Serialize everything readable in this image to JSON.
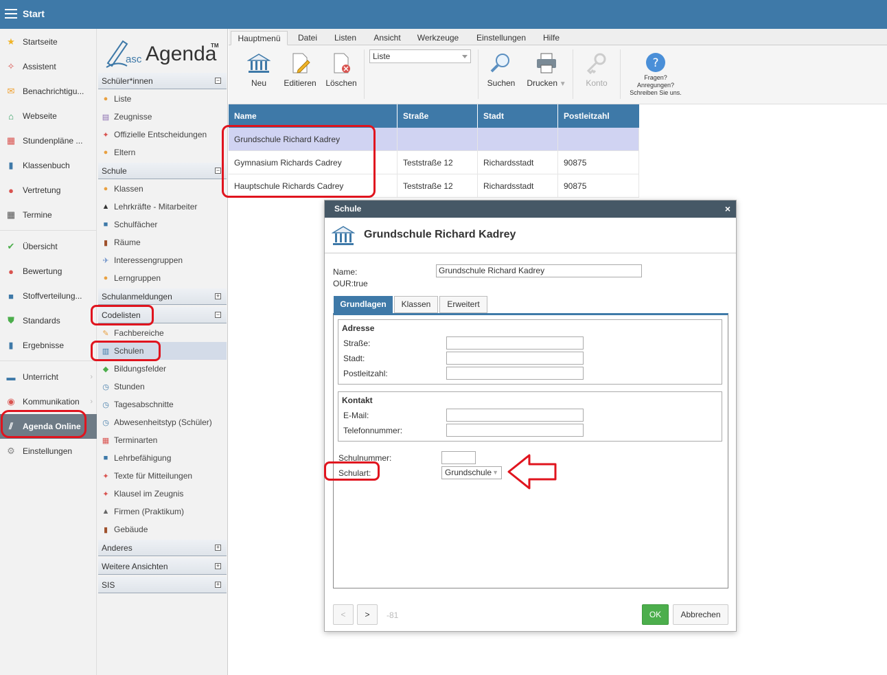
{
  "topbar": {
    "title": "Start"
  },
  "leftnav": {
    "items": [
      {
        "label": "Startseite",
        "icon": "star-icon",
        "color": "#f0b428"
      },
      {
        "label": "Assistent",
        "icon": "magic-wand-icon",
        "color": "#d9534f"
      },
      {
        "label": "Benachrichtigu...",
        "icon": "envelope-icon",
        "color": "#f0a030"
      },
      {
        "label": "Webseite",
        "icon": "house-icon",
        "color": "#2e9e5e"
      },
      {
        "label": "Stundenpläne ...",
        "icon": "timetable-icon",
        "color": "#d9534f"
      },
      {
        "label": "Klassenbuch",
        "icon": "book-icon",
        "color": "#3e79a8"
      },
      {
        "label": "Vertretung",
        "icon": "person-icon",
        "color": "#d9534f"
      },
      {
        "label": "Termine",
        "icon": "calendar-icon",
        "color": "#555"
      },
      {
        "label": "Übersicht",
        "icon": "check-circle-icon",
        "color": "#4cae4c"
      },
      {
        "label": "Bewertung",
        "icon": "grade-icon",
        "color": "#d9534f"
      },
      {
        "label": "Stoffverteilung...",
        "icon": "briefcase-icon",
        "color": "#3e79a8"
      },
      {
        "label": "Standards",
        "icon": "shield-check-icon",
        "color": "#4cae4c"
      },
      {
        "label": "Ergebnisse",
        "icon": "bar-chart-icon",
        "color": "#3e79a8"
      },
      {
        "label": "Unterricht",
        "icon": "desk-icon",
        "color": "#3e79a8"
      },
      {
        "label": "Kommunikation",
        "icon": "chat-icon",
        "color": "#d9534f"
      },
      {
        "label": "Agenda Online",
        "icon": "agenda-logo-icon",
        "color": "#ffffff"
      },
      {
        "label": "Einstellungen",
        "icon": "gear-icon",
        "color": "#888"
      }
    ]
  },
  "tree": {
    "logo": {
      "prefix": "asc",
      "name": "Agenda",
      "tm": "TM"
    },
    "sections": [
      {
        "label": "Schüler*innen",
        "toggle": "−"
      },
      {
        "label": "Schule",
        "toggle": "−"
      },
      {
        "label": "Schulanmeldungen",
        "toggle": "+"
      },
      {
        "label": "Codelisten",
        "toggle": "−"
      },
      {
        "label": "Anderes",
        "toggle": "+"
      },
      {
        "label": "Weitere Ansichten",
        "toggle": "+"
      },
      {
        "label": "SIS",
        "toggle": "+"
      }
    ],
    "items": [
      "Liste",
      "Zeugnisse",
      "Offizielle Entscheidungen",
      "Eltern",
      "Klassen",
      "Lehrkräfte - Mitarbeiter",
      "Schulfächer",
      "Räume",
      "Interessengruppen",
      "Lerngruppen",
      "Fachbereiche",
      "Schulen",
      "Bildungsfelder",
      "Stunden",
      "Tagesabschnitte",
      "Abwesenheitstyp (Schüler)",
      "Terminarten",
      "Lehrbefähigung",
      "Texte für Mitteilungen",
      "Klausel im Zeugnis",
      "Firmen (Praktikum)",
      "Gebäude"
    ]
  },
  "ribbon": {
    "tabs": [
      "Hauptmenü",
      "Datei",
      "Listen",
      "Ansicht",
      "Werkzeuge",
      "Einstellungen",
      "Hilfe"
    ],
    "buttons": {
      "neu": "Neu",
      "edit": "Editieren",
      "del": "Löschen",
      "search": "Suchen",
      "print": "Drucken",
      "konto": "Konto"
    },
    "view_select": "Liste",
    "help": [
      "Fragen?",
      "Anregungen?",
      "Schreiben Sie uns."
    ]
  },
  "grid": {
    "columns": [
      "Name",
      "Straße",
      "Stadt",
      "Postleitzahl"
    ],
    "rows": [
      [
        "Grundschule Richard Kadrey",
        "",
        "",
        ""
      ],
      [
        "Gymnasium Richards Cadrey",
        "Teststraße 12",
        "Richardsstadt",
        "90875"
      ],
      [
        "Hauptschule Richards Cadrey",
        "Teststraße 12",
        "Richardsstadt",
        "90875"
      ]
    ]
  },
  "dialog": {
    "title": "Schule",
    "close": "×",
    "heading": "Grundschule Richard Kadrey",
    "name_label": "Name:",
    "name_value": "Grundschule Richard Kadrey",
    "our_label": "OUR:true",
    "tabs": [
      "Grundlagen",
      "Klassen",
      "Erweitert"
    ],
    "adresse": {
      "title": "Adresse",
      "strasse": "Straße:",
      "stadt": "Stadt:",
      "plz": "Postleitzahl:"
    },
    "kontakt": {
      "title": "Kontakt",
      "email": "E-Mail:",
      "telefon": "Telefonnummer:"
    },
    "schulnummer_label": "Schulnummer:",
    "schulart_label": "Schulart:",
    "schulart_value": "Grundschule",
    "nav_prev": "<",
    "nav_next": ">",
    "record_id": "-81",
    "ok": "OK",
    "cancel": "Abbrechen"
  },
  "colors": {
    "header": "#3e79a8",
    "dialog_title": "#465866",
    "ok": "#4cae4c",
    "annotation": "#e0141e"
  }
}
